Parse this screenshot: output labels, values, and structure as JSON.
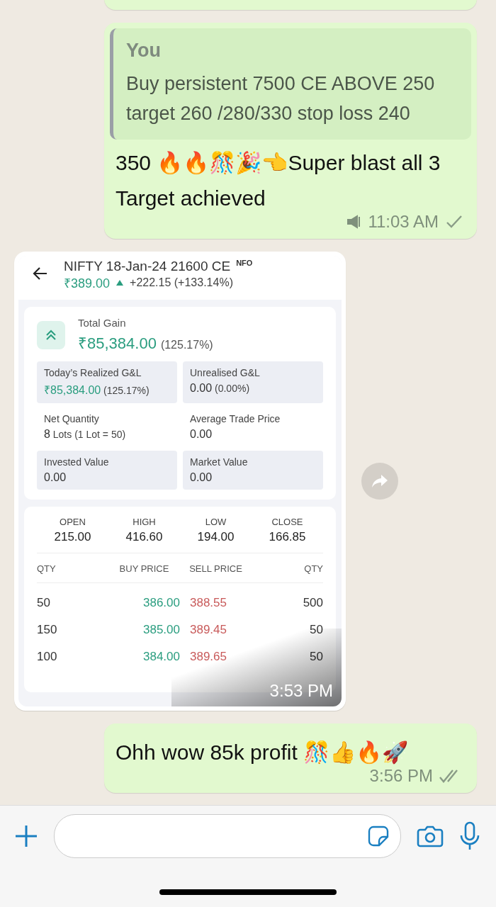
{
  "messages": [
    {
      "kind": "stub",
      "outgoing": true
    },
    {
      "kind": "text",
      "outgoing": true,
      "quote": {
        "author": "You",
        "text": "Buy persistent 7500 CE ABOVE 250 target 260 /280/330 stop loss 240"
      },
      "text": "350 🔥🔥🎊🎉👈Super blast all 3 Target achieved",
      "broadcast": true,
      "time": "11:03 AM",
      "read": false
    },
    {
      "kind": "image",
      "outgoing": false,
      "time": "3:53 PM",
      "screen": {
        "title": "NIFTY 18-Jan-24 21600 CE",
        "exchange": "NFO",
        "price": "₹389.00",
        "change": "+222.15 (+133.14%)",
        "gain_label": "Total Gain",
        "gain_value": "₹85,384.00",
        "gain_pct": "(125.17%)",
        "stats": [
          {
            "label": "Today’s Realized G&L",
            "value": "₹85,384.00",
            "extra": "(125.17%)",
            "shaded": true,
            "positive": true
          },
          {
            "label": "Unrealised G&L",
            "value": "0.00",
            "extra": "(0.00%)",
            "shaded": true,
            "positive": false
          },
          {
            "label": "Net Quantity",
            "value": "8",
            "extra": "Lots (1 Lot = 50)",
            "shaded": false,
            "positive": false
          },
          {
            "label": "Average Trade Price",
            "value": "0.00",
            "shaded": false,
            "positive": false
          },
          {
            "label": "Invested Value",
            "value": "0.00",
            "shaded": true,
            "positive": false
          },
          {
            "label": "Market Value",
            "value": "0.00",
            "shaded": true,
            "positive": false
          }
        ],
        "ohlc": [
          {
            "label": "OPEN",
            "value": "215.00"
          },
          {
            "label": "HIGH",
            "value": "416.60"
          },
          {
            "label": "LOW",
            "value": "194.00"
          },
          {
            "label": "CLOSE",
            "value": "166.85"
          }
        ],
        "depth_columns": [
          "QTY",
          "BUY PRICE",
          "SELL PRICE",
          "QTY"
        ],
        "depth_rows": [
          [
            "50",
            "386.00",
            "388.55",
            "500"
          ],
          [
            "150",
            "385.00",
            "389.45",
            "50"
          ],
          [
            "100",
            "384.00",
            "389.65",
            "50"
          ]
        ]
      }
    },
    {
      "kind": "text",
      "outgoing": true,
      "text": "Ohh wow 85k profit 🎊👍🔥🚀",
      "time": "3:56 PM",
      "read": true
    }
  ]
}
